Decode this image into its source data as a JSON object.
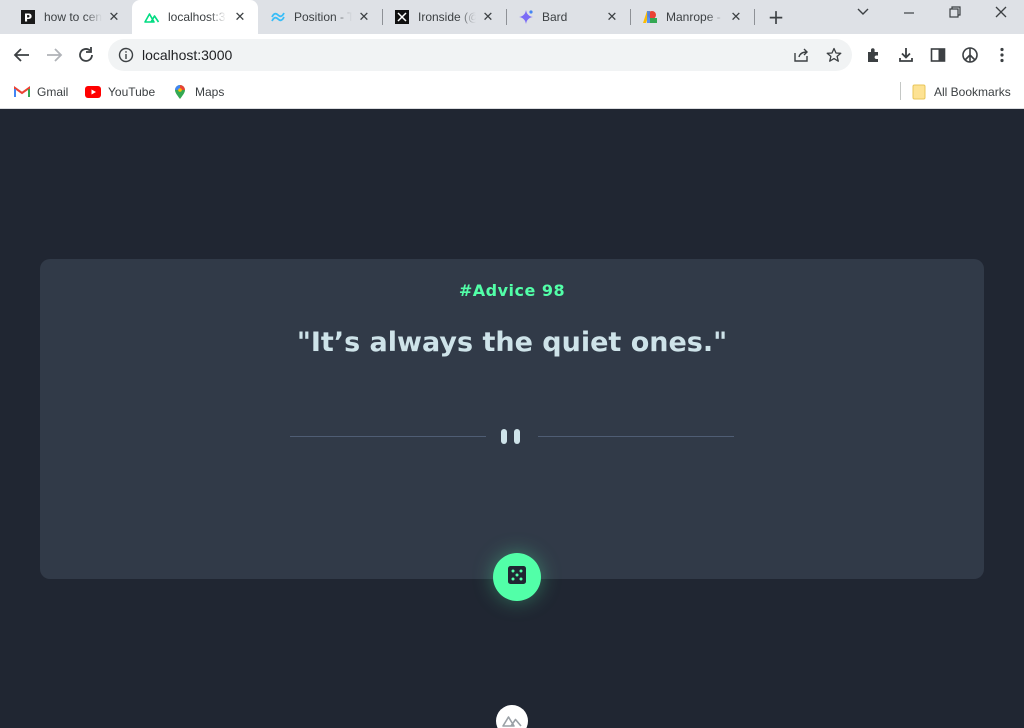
{
  "tabs": [
    {
      "title": "how to cen",
      "icon": "perplexity-icon"
    },
    {
      "title": "localhost:3",
      "icon": "nuxt-icon",
      "active": true
    },
    {
      "title": "Position - T",
      "icon": "tailwind-icon"
    },
    {
      "title": "Ironside (@",
      "icon": "x-icon"
    },
    {
      "title": "Bard",
      "icon": "bard-icon"
    },
    {
      "title": "Manrope -",
      "icon": "google-fonts-icon"
    }
  ],
  "toolbar": {
    "url": "localhost:3000"
  },
  "bookmarks": [
    {
      "label": "Gmail",
      "icon": "gmail-icon"
    },
    {
      "label": "YouTube",
      "icon": "youtube-icon"
    },
    {
      "label": "Maps",
      "icon": "maps-icon"
    }
  ],
  "all_bookmarks": "All Bookmarks",
  "advice": {
    "id_label": "#Advice 98",
    "text": "\"It’s always the quiet ones.\""
  },
  "colors": {
    "page_bg": "#202632",
    "card_bg": "#313a48",
    "accent": "#52ffa8",
    "quote_text": "#cee3e9",
    "divider": "#4f5d74"
  }
}
